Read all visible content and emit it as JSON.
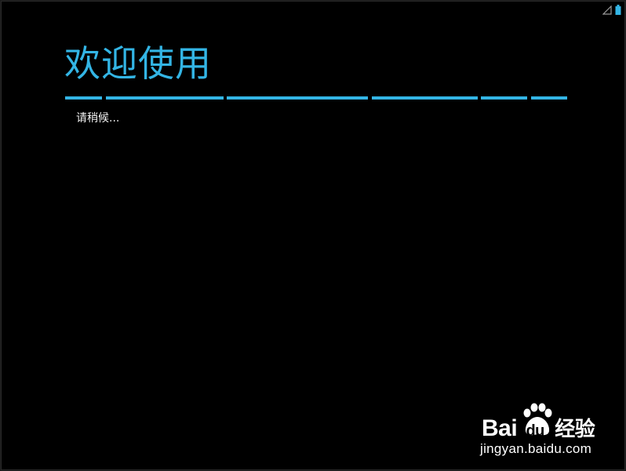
{
  "status_bar": {
    "icons": [
      "signal-icon",
      "battery-icon"
    ]
  },
  "main": {
    "title": "欢迎使用",
    "status_text": "请稍候...",
    "accent_color": "#33b5e5"
  },
  "watermark": {
    "brand_left": "Bai",
    "brand_mid": "du",
    "brand_cn": "经验",
    "url": "jingyan.baidu.com"
  }
}
